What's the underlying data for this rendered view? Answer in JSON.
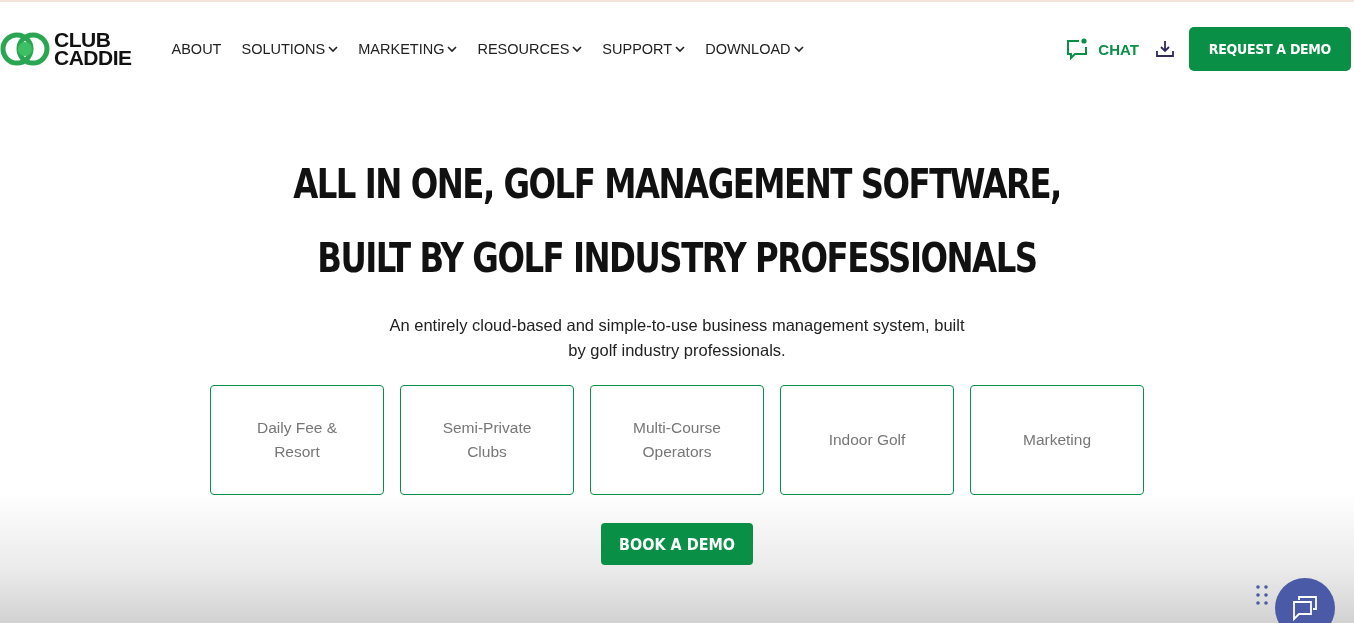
{
  "logo": {
    "line1": "CLUB",
    "line2": "CADDIE"
  },
  "nav": [
    {
      "label": "ABOUT",
      "dropdown": false
    },
    {
      "label": "SOLUTIONS",
      "dropdown": true
    },
    {
      "label": "MARKETING",
      "dropdown": true
    },
    {
      "label": "RESOURCES",
      "dropdown": true
    },
    {
      "label": "SUPPORT",
      "dropdown": true
    },
    {
      "label": "DOWNLOAD",
      "dropdown": true
    }
  ],
  "chat": {
    "label": "CHAT"
  },
  "request_demo": "REQUEST A DEMO",
  "headline": [
    "ALL IN ONE, GOLF MANAGEMENT SOFTWARE,",
    "BUILT BY GOLF INDUSTRY PROFESSIONALS"
  ],
  "subtitle": "An entirely cloud-based and simple-to-use business management system, built by golf industry professionals.",
  "categories": [
    "Daily Fee & Resort",
    "Semi-Private Clubs",
    "Multi-Course Operators",
    "Indoor Golf",
    "Marketing"
  ],
  "book_demo": "BOOK A DEMO"
}
